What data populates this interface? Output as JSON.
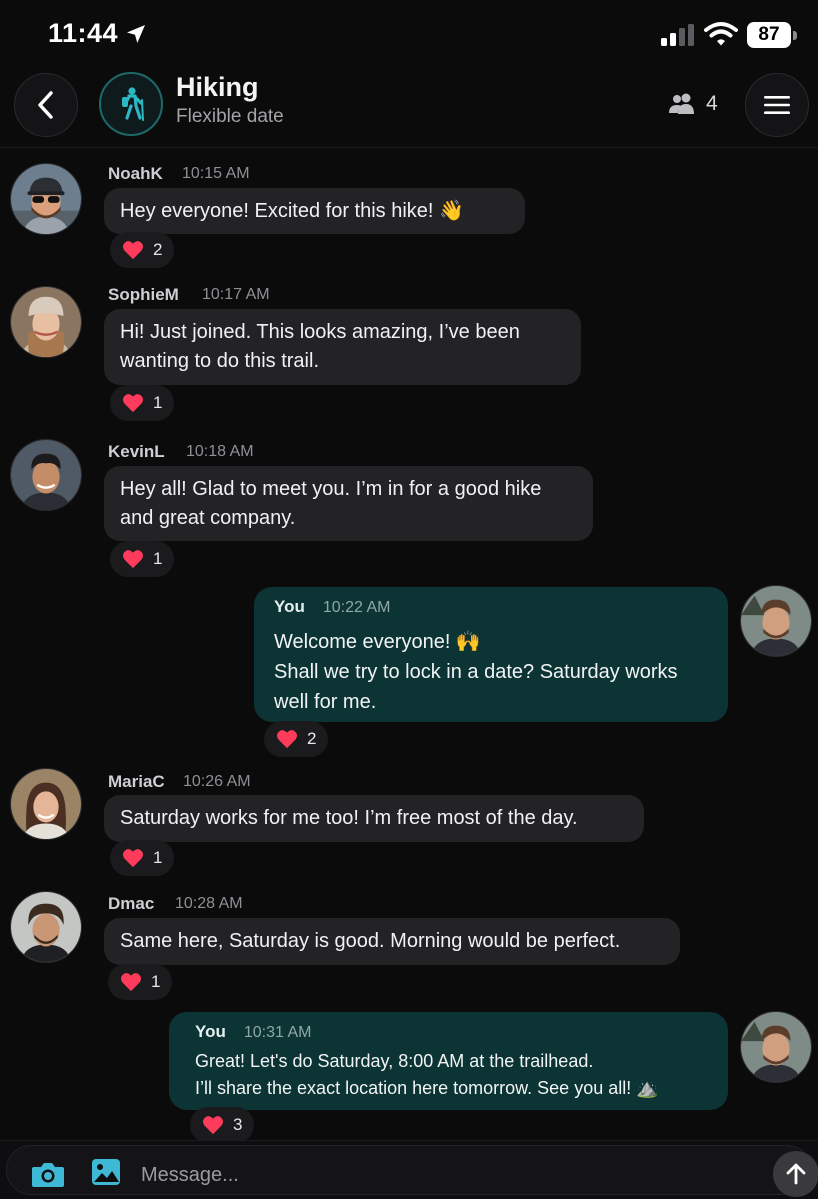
{
  "status_bar": {
    "time": "11:44",
    "battery": "87"
  },
  "header": {
    "title": "Hiking",
    "subtitle": "Flexible date",
    "member_count": "4"
  },
  "messages": [
    {
      "name": "NoahK",
      "time": "10:15 AM",
      "lines": [
        "Hey everyone! Excited for this hike! 👋"
      ],
      "reactions": "2"
    },
    {
      "name": "SophieM",
      "time": "10:17 AM",
      "lines": [
        "Hi! Just joined. This looks amazing, I’ve been",
        "wanting to do this trail."
      ],
      "reactions": "1"
    },
    {
      "name": "KevinL",
      "time": "10:18 AM",
      "lines": [
        "Hey all! Glad to meet you. I’m in for a good hike",
        "and great company."
      ],
      "reactions": "1"
    },
    {
      "name": "You",
      "time": "10:22 AM",
      "lines": [
        "Welcome everyone!  🙌",
        "Shall we try to lock in a date? Saturday works",
        "well for me."
      ],
      "reactions": "2"
    },
    {
      "name": "MariaC",
      "time": "10:26 AM",
      "lines": [
        "Saturday works for me too! I’m free most of the day."
      ],
      "reactions": "1"
    },
    {
      "name": "Dmac",
      "time": "10:28 AM",
      "lines": [
        "Same here, Saturday is good. Morning would be perfect."
      ],
      "reactions": "1"
    },
    {
      "name": "You",
      "time": "10:31 AM",
      "lines": [
        "Great! Let's do Saturday, 8:00 AM at the trailhead.",
        "I’ll share the exact location here tomorrow. See you all! ⛰️"
      ],
      "reactions": "3"
    }
  ],
  "composer": {
    "placeholder": "Message..."
  },
  "icons": {
    "back": "chevron-left-icon",
    "group": "hiker-icon",
    "members": "people-icon",
    "menu": "hamburger-icon",
    "reaction": "heart-icon",
    "camera": "camera-icon",
    "image": "image-icon",
    "send": "arrow-up-icon"
  },
  "colors": {
    "accent": "#2bb8c4",
    "self_bubble": "#0d3434",
    "other_bubble": "#232325",
    "heart": "#ff3b5c"
  }
}
